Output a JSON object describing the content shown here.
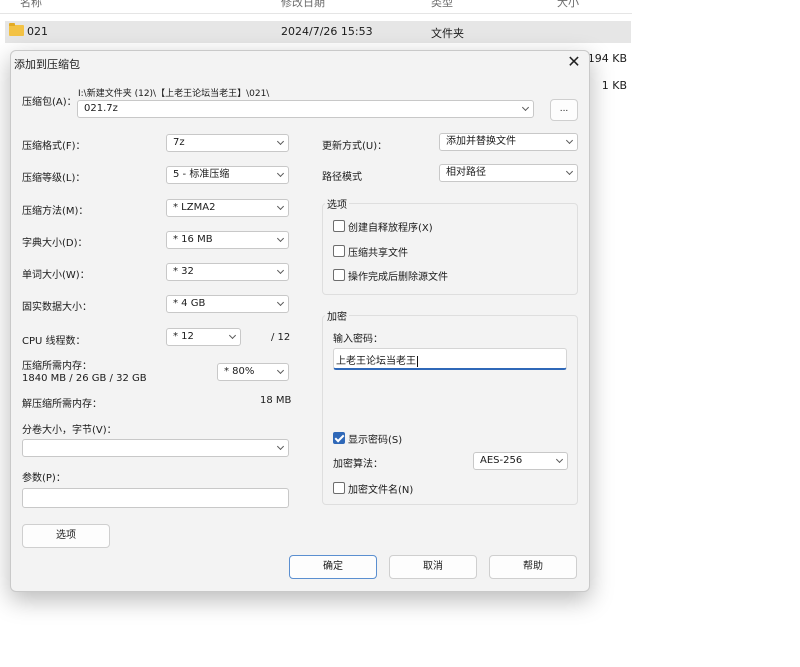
{
  "explorer": {
    "columns": {
      "name": "名称",
      "modified": "修改日期",
      "type": "类型",
      "size": "大小"
    },
    "rows": [
      {
        "name": "021",
        "modified": "2024/7/26 15:53",
        "type": "文件夹"
      }
    ],
    "side_sizes": [
      "194 KB",
      "1 KB"
    ]
  },
  "dialog": {
    "title": "添加到压缩包",
    "archive_label": "压缩包(A)：",
    "archive_path": "I:\\新建文件夹 (12)\\【上老王论坛当老王】\\021\\",
    "archive_name": "021.7z",
    "browse_label": "...",
    "left": {
      "format_label": "压缩格式(F)：",
      "format_value": "7z",
      "level_label": "压缩等级(L)：",
      "level_value": "5 - 标准压缩",
      "method_label": "压缩方法(M)：",
      "method_value": "* LZMA2",
      "dict_label": "字典大小(D)：",
      "dict_value": "* 16 MB",
      "word_label": "单词大小(W)：",
      "word_value": "* 32",
      "solid_label": "固实数据大小：",
      "solid_value": "* 4 GB",
      "threads_label": "CPU 线程数：",
      "threads_value": "* 12",
      "threads_total": "/ 12",
      "mem_label": "压缩所需内存：",
      "mem_detail": "1840 MB / 26 GB / 32 GB",
      "mem_value": "* 80%",
      "decomp_label": "解压缩所需内存：",
      "decomp_value": "18 MB",
      "split_label": "分卷大小，字节(V)：",
      "split_value": "",
      "params_label": "参数(P)：",
      "params_value": "",
      "options_button": "选项"
    },
    "right": {
      "update_label": "更新方式(U)：",
      "update_value": "添加并替换文件",
      "pathmode_label": "路径模式",
      "pathmode_value": "相对路径",
      "options_group": "选项",
      "opt_sfx": {
        "label": "创建自释放程序(X)",
        "checked": false
      },
      "opt_shared": {
        "label": "压缩共享文件",
        "checked": false
      },
      "opt_delete": {
        "label": "操作完成后删除源文件",
        "checked": false
      },
      "encrypt_group": "加密",
      "password_label": "输入密码：",
      "password_value": "上老王论坛当老王",
      "show_password": {
        "label": "显示密码(S)",
        "checked": true
      },
      "algo_label": "加密算法：",
      "algo_value": "AES-256",
      "encrypt_names": {
        "label": "加密文件名(N)",
        "checked": false
      }
    },
    "buttons": {
      "ok": "确定",
      "cancel": "取消",
      "help": "帮助"
    }
  }
}
